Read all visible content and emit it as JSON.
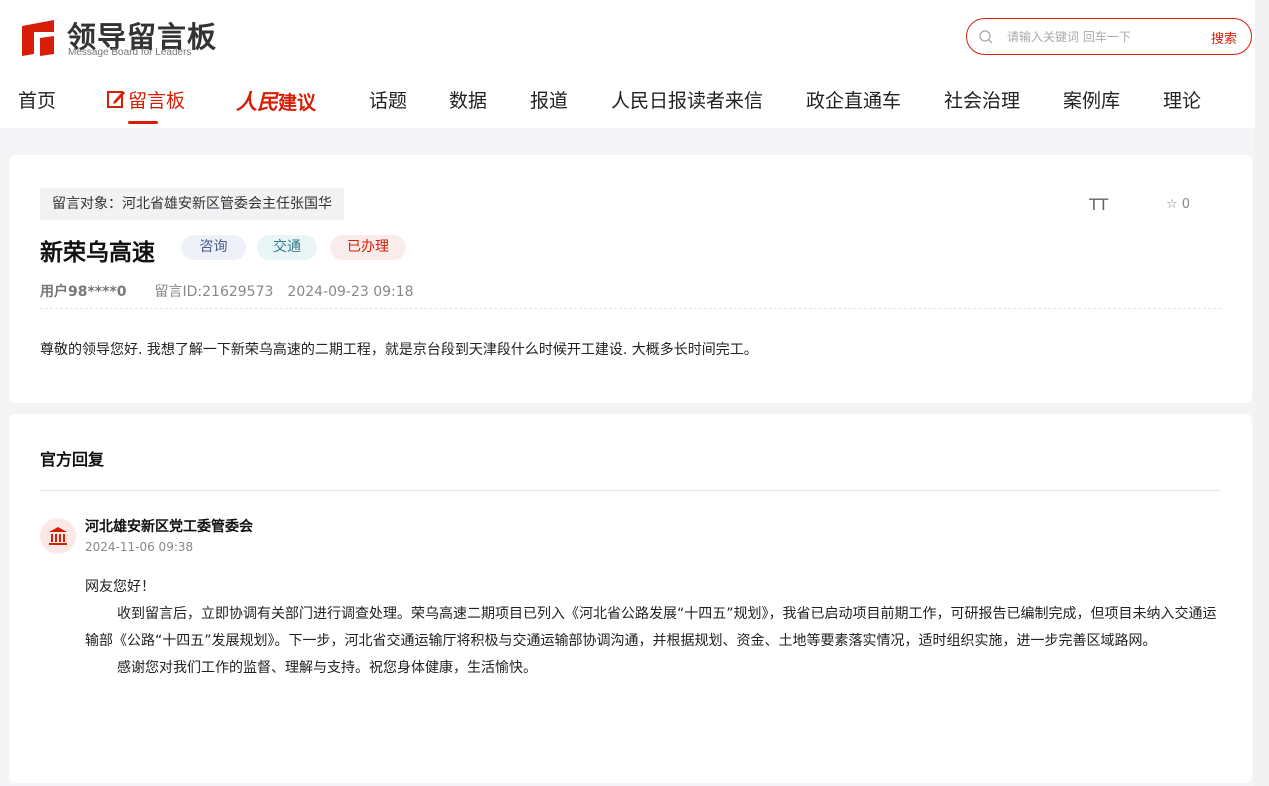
{
  "header": {
    "logo_title": "领导留言板",
    "logo_subtitle": "Message Board for Leaders",
    "search_placeholder": "请输入关键词 回车一下",
    "search_button": "搜索"
  },
  "nav": {
    "items": [
      {
        "label": "首页"
      },
      {
        "label": "留言板"
      },
      {
        "label_script": "人民",
        "label": "建议"
      },
      {
        "label": "话题"
      },
      {
        "label": "数据"
      },
      {
        "label": "报道"
      },
      {
        "label": "人民日报读者来信"
      },
      {
        "label": "政企直通车"
      },
      {
        "label": "社会治理"
      },
      {
        "label": "案例库"
      },
      {
        "label": "理论"
      }
    ],
    "active_color": "#d81e06"
  },
  "message": {
    "target": "留言对象：河北省雄安新区管委会主任张国华",
    "font_toggle": "TT",
    "favorite_count": "0",
    "title": "新荣乌高速",
    "tags": [
      "咨询",
      "交通",
      "已办理"
    ],
    "user": "用户98****0",
    "message_id": "留言ID:21629573",
    "datetime": "2024-09-23 09:18",
    "content": "尊敬的领导您好. 我想了解一下新荣乌高速的二期工程，就是京台段到天津段什么时候开工建设. 大概多长时间完工。"
  },
  "reply": {
    "heading": "官方回复",
    "org_name": "河北雄安新区党工委管委会",
    "date": "2024-11-06 09:38",
    "greeting": "网友您好！",
    "paragraph1": "收到留言后，立即协调有关部门进行调查处理。荣乌高速二期项目已列入《河北省公路发展“十四五”规划》，我省已启动项目前期工作，可研报告已编制完成，但项目未纳入交通运输部《公路“十四五”发展规划》。下一步，河北省交通运输厅将积极与交通运输部协调沟通，并根据规划、资金、土地等要素落实情况，适时组织实施，进一步完善区域路网。",
    "paragraph2": "感谢您对我们工作的监督、理解与支持。祝您身体健康，生活愉快。"
  }
}
